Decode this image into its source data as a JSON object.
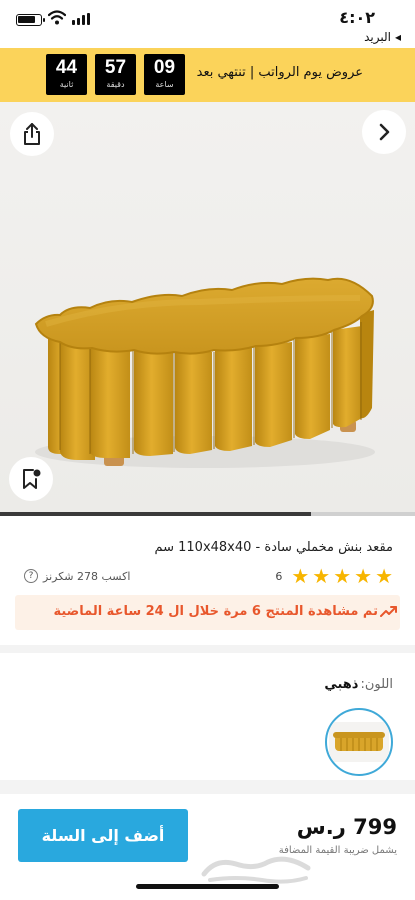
{
  "status": {
    "time": "٤:٠٢",
    "back_app": "البريد",
    "back_chevron": "◂"
  },
  "promo": {
    "text": "عروض يوم الرواتب | تنتهي بعد",
    "timer": [
      {
        "value": "09",
        "label": "ساعة"
      },
      {
        "value": "57",
        "label": "دقيقة"
      },
      {
        "value": "44",
        "label": "ثانية"
      }
    ]
  },
  "gallery": {
    "share_icon": "share-icon",
    "next_icon": "chevron-right-icon",
    "save_icon": "bookmark-icon",
    "progress": 0.75
  },
  "product": {
    "title": "مقعد بنش مخملي سادة - 110x48x40 سم",
    "rating_stars": 5,
    "review_count": "6",
    "points": "اكسب 278 شكرنز",
    "views_notice": "تم مشاهدة المنتج 6 مرة خلال ال 24 ساعة الماضية",
    "color_label": "اللون:",
    "color_value": "ذهبي"
  },
  "purchase": {
    "add_to_cart": "أضف إلى السلة",
    "price": "799 ر.س",
    "vat_note": "يشمل ضريبة القيمة المضافة"
  },
  "colors": {
    "promo_bg": "#fbd35a",
    "accent_blue": "#29a8de",
    "star": "#f7b500",
    "notice_text": "#e8572c",
    "notice_bg": "#fdf1e7",
    "product_mustard": "#d9a52a"
  }
}
